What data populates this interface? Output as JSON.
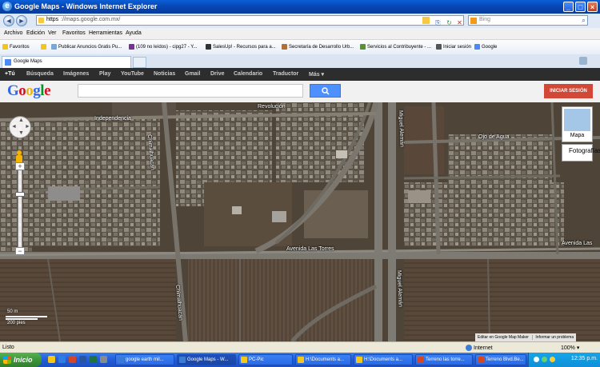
{
  "window": {
    "title": "Google Maps - Windows Internet Explorer",
    "minimize": "_",
    "maximize": "□",
    "close": "×"
  },
  "address": {
    "protocol": "https",
    "host": "://maps.google.com.mx/",
    "search_placeholder": "Bing",
    "back": "◄",
    "forward": "►"
  },
  "menu": [
    "Archivo",
    "Edición",
    "Ver",
    "Favoritos",
    "Herramientas",
    "Ayuda"
  ],
  "favorites": {
    "label": "Favoritos",
    "items": [
      "Publicar Anuncios Gratis  Pu...",
      "(109 no leídos) - cipg27 - Y...",
      "SalesUp! - Recursos para a...",
      "Secretaría de Desarrollo Urb...",
      "Servicios al Contribuyente - ...",
      "Iniciar sesión",
      "Google"
    ]
  },
  "tab": {
    "label": "Google Maps"
  },
  "gbar": [
    "+Tú",
    "Búsqueda",
    "Imágenes",
    "Play",
    "YouTube",
    "Noticias",
    "Gmail",
    "Drive",
    "Calendario",
    "Traductor",
    "Más ▾"
  ],
  "google": {
    "logo": "Google",
    "signin": "INICIAR SESIÓN",
    "search_icon": "🔍"
  },
  "map": {
    "labels": {
      "revolucion": "Revolución",
      "independencia": "Independencia",
      "chimalhuacan": "Chimalhuacán",
      "chimalhuacan2": "Chimalhuacán",
      "miguel1": "Miguel Alemán",
      "miguel2": "Miguel Alemán",
      "ojo": "Ojo de Agua",
      "avenida1": "Avenida Las Torres",
      "avenida2": "Avenida Las"
    },
    "map_type": "Mapa",
    "sat_type": "Fotografías",
    "scale_m": "50 m",
    "scale_ft": "200 pies",
    "zoom_in": "+",
    "zoom_out": "−",
    "report1": "Editar en Google Map Maker",
    "report2": "Informar un problema"
  },
  "status": {
    "text": "Listo",
    "zone": "Internet",
    "zoom": "100%"
  },
  "taskbar": {
    "start": "Inicio",
    "buttons": [
      "google earth mil...",
      "Google Maps - W...",
      "PC-Pic",
      "H:\\Documents a...",
      "H:\\Documents a...",
      "Terreno las torre...",
      "Terreno Blvd.Be..."
    ],
    "clock": "12:35 p.m."
  }
}
